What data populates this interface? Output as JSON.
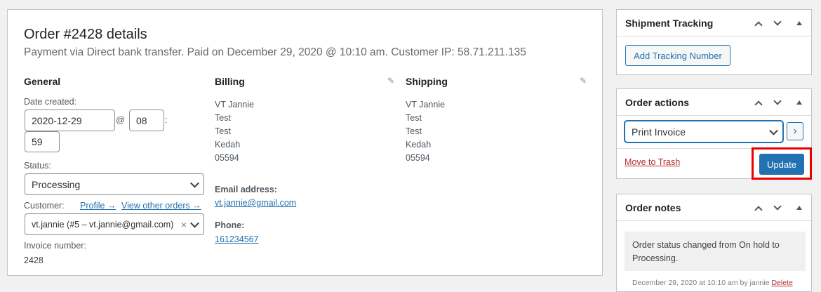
{
  "order": {
    "title": "Order #2428 details",
    "subtitle": "Payment via Direct bank transfer. Paid on December 29, 2020 @ 10:10 am. Customer IP: 58.71.211.135"
  },
  "general": {
    "heading": "General",
    "date_label": "Date created:",
    "date_value": "2020-12-29",
    "at_sep": "@",
    "hour_value": "08",
    "colon_sep": ":",
    "minute_value": "59",
    "status_label": "Status:",
    "status_value": "Processing",
    "customer_label": "Customer:",
    "profile_link": "Profile →",
    "view_orders_link": "View other orders →",
    "customer_value": "vt.jannie (#5 – vt.jannie@gmail.com)",
    "clear_glyph": "×",
    "invoice_label": "Invoice number:",
    "invoice_value": "2428"
  },
  "billing": {
    "heading": "Billing",
    "lines": [
      "VT Jannie",
      "Test",
      "Test",
      "Kedah",
      "05594"
    ],
    "email_label": "Email address:",
    "email_value": "vt.jannie@gmail.com",
    "phone_label": "Phone:",
    "phone_value": "161234567"
  },
  "shipping": {
    "heading": "Shipping",
    "lines": [
      "VT Jannie",
      "Test",
      "Test",
      "Kedah",
      "05594"
    ]
  },
  "shipment_tracking": {
    "title": "Shipment Tracking",
    "button": "Add Tracking Number"
  },
  "order_actions": {
    "title": "Order actions",
    "select_value": "Print Invoice",
    "go_glyph": "›",
    "trash_link": "Move to Trash",
    "update_button": "Update"
  },
  "order_notes": {
    "title": "Order notes",
    "note_text": "Order status changed from On hold to Processing.",
    "note_meta_prefix": "December 29, 2020 at 10:10 am by jannie",
    "note_delete": "Delete"
  },
  "icons": {
    "pencil": "✎",
    "highlight_color": "#ea0000",
    "primary_color": "#2271b1"
  }
}
